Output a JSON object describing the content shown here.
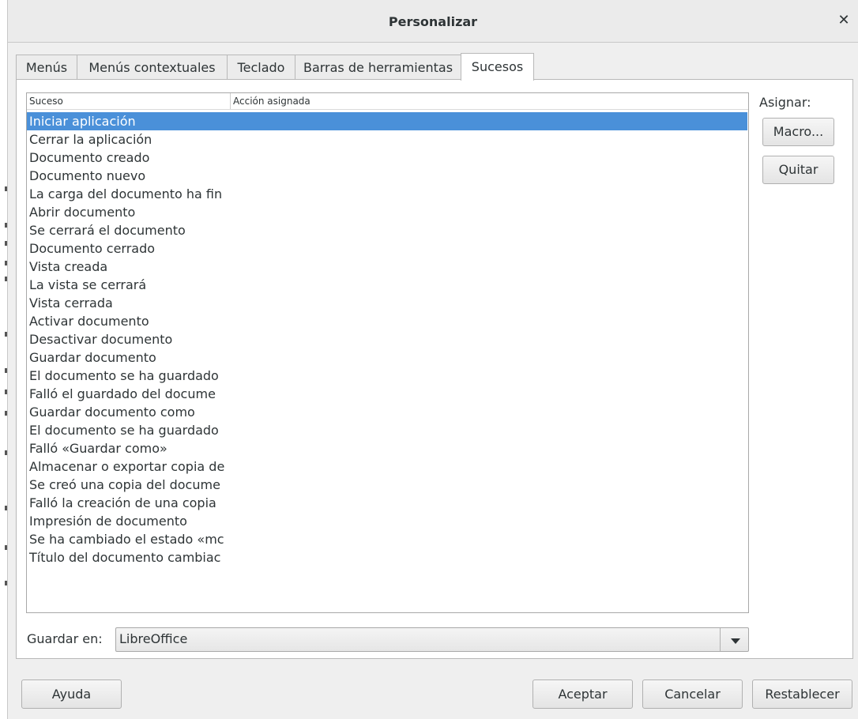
{
  "dialog": {
    "title": "Personalizar",
    "close_icon": "close-icon"
  },
  "tabs": [
    {
      "label": "Menús",
      "active": false
    },
    {
      "label": "Menús contextuales",
      "active": false
    },
    {
      "label": "Teclado",
      "active": false
    },
    {
      "label": "Barras de herramientas",
      "active": false
    },
    {
      "label": "Sucesos",
      "active": true
    }
  ],
  "events": {
    "columns": [
      "Suceso",
      "Acción asignada"
    ],
    "rows": [
      "Iniciar aplicación",
      "Cerrar la aplicación",
      "Documento creado",
      "Documento nuevo",
      "La carga del documento ha fin",
      "Abrir documento",
      "Se cerrará el documento",
      "Documento cerrado",
      "Vista creada",
      "La vista se cerrará",
      "Vista cerrada",
      "Activar documento",
      "Desactivar documento",
      "Guardar documento",
      "El documento se ha guardado",
      "Falló el guardado del docume",
      "Guardar documento como",
      "El documento se ha guardado",
      "Falló «Guardar como»",
      "Almacenar o exportar copia de",
      "Se creó una copia del docume",
      "Falló la creación de una copia",
      "Impresión de documento",
      "Se ha cambiado el estado «mc",
      "Título del documento cambiac"
    ],
    "selected_index": 0
  },
  "assign": {
    "label": "Asignar:",
    "macro_button": "Macro...",
    "remove_button": "Quitar"
  },
  "save_in": {
    "label": "Guardar en:",
    "value": "LibreOffice"
  },
  "buttons": {
    "help": "Ayuda",
    "ok": "Aceptar",
    "cancel": "Cancelar",
    "reset": "Restablecer"
  },
  "colors": {
    "selection": "#4a90d9",
    "dialog_bg": "#efefef"
  }
}
